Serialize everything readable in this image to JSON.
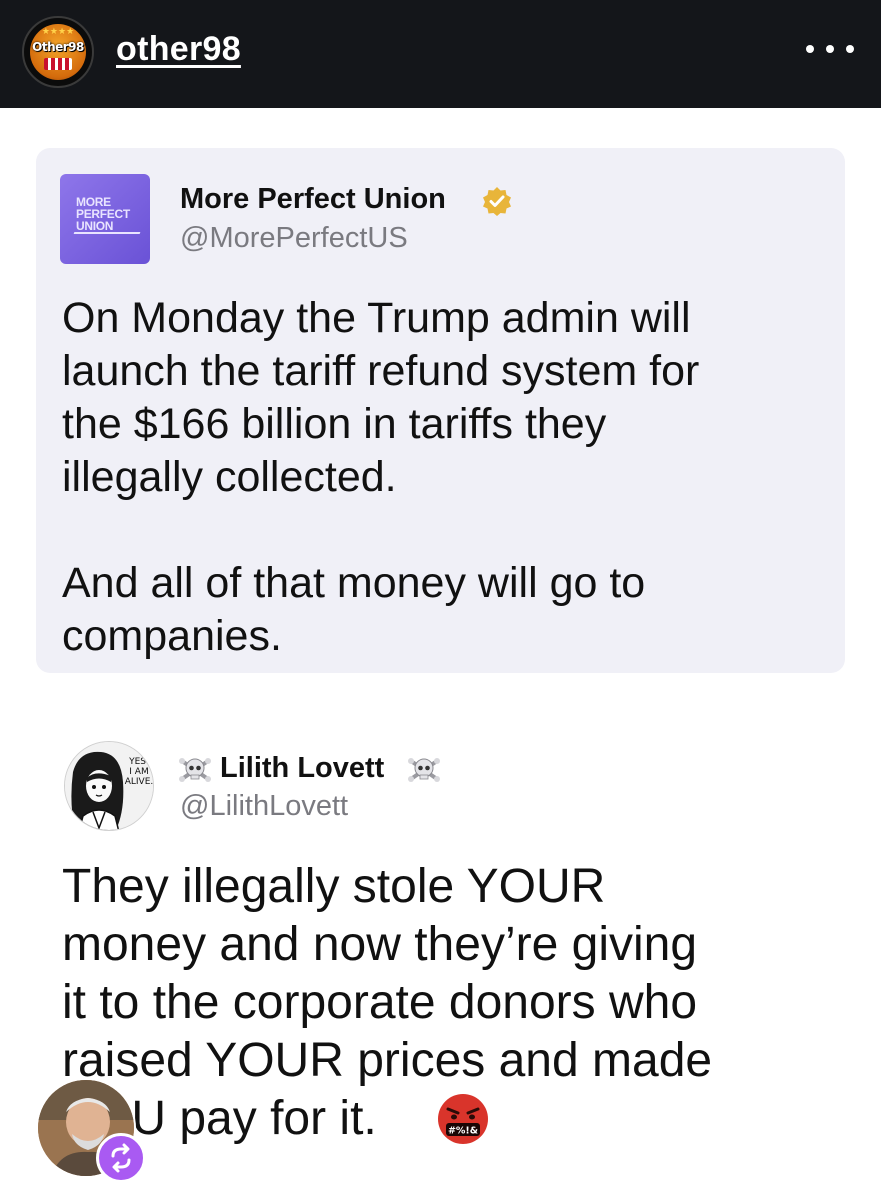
{
  "header": {
    "username": "other98",
    "avatar_text": "Other98",
    "avatar_icon": "other98-logo-icon",
    "more_icon": "more-options-icon"
  },
  "tweet1": {
    "logo_lines": [
      "MORE",
      "PERFECT",
      "UNION"
    ],
    "display_name": "More Perfect Union",
    "verified_icon": "verified-badge-icon",
    "handle": "@MorePerfectUS",
    "body": "On Monday the Trump admin will\nlaunch the tariff refund system for\nthe $166 billion in tariffs they\nillegally collected.\n\nAnd all of that money will go to\ncompanies."
  },
  "tweet2": {
    "avatar_text": "YES.\nI AM\nALIVE.",
    "display_name": "Lilith Lovett",
    "name_icons": [
      "skull-crossbones-icon",
      "skull-crossbones-icon"
    ],
    "handle": "@LilithLovett",
    "body": "They illegally stole YOUR\nmoney and now they’re giving\nit to the corporate donors who\nraised YOUR prices and made\nYOU pay for it.",
    "emoji": "swearing-face-emoji",
    "emoji_text": "#%!&"
  },
  "footer": {
    "reposter_icon": "reposter-avatar",
    "repost_icon": "repost-icon",
    "colors": {
      "repost_badge": "#a95af2",
      "header_bg": "#14161a",
      "card_bg": "#f0f0f7",
      "logo_purple": "#7a62e0"
    }
  }
}
